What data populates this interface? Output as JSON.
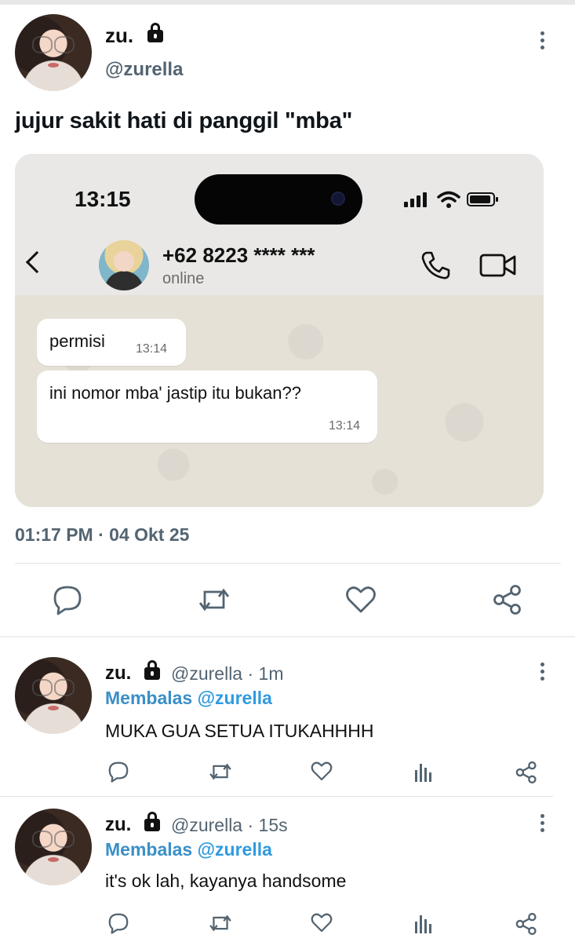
{
  "tweet": {
    "name": "zu.",
    "handle": "@zurella",
    "text": "jujur sakit hati di panggil \"mba\"",
    "timestamp": "01:17 PM · 04 Okt 25"
  },
  "media": {
    "phone_clock": "13:15",
    "contact_name": "+62 8223 **** ***",
    "contact_status": "online",
    "messages": [
      {
        "text": "permisi",
        "time": "13:14"
      },
      {
        "text": "ini nomor mba' jastip itu bukan??",
        "time": "13:14"
      }
    ]
  },
  "actions": [
    "reply-icon",
    "retweet-icon",
    "like-icon",
    "share-icon"
  ],
  "replies": [
    {
      "name": "zu.",
      "meta": "@zurella · 1m",
      "replying_prefix": "Membalas",
      "replying_mention": "@zurella",
      "text": "MUKA GUA SETUA ITUKAHHHH"
    },
    {
      "name": "zu.",
      "meta": "@zurella · 15s",
      "replying_prefix": "Membalas",
      "replying_mention": "@zurella",
      "text": "it's ok lah, kayanya handsome"
    }
  ],
  "colors": {
    "accent": "#2f9be0",
    "muted": "#536471"
  }
}
